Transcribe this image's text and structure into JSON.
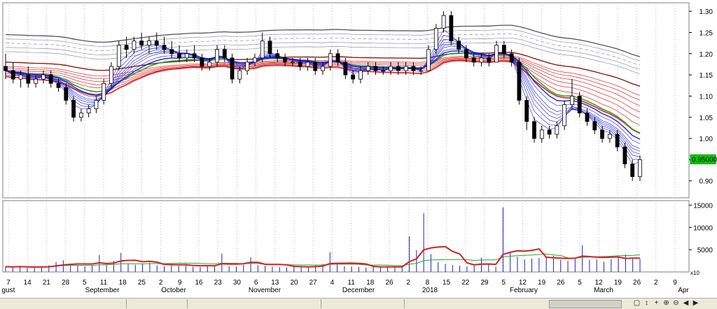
{
  "chart_data": [
    {
      "type": "candlestick",
      "ylim": [
        0.86,
        1.32
      ],
      "yticks": [
        "0.90",
        "0.95",
        "1.00",
        "1.05",
        "1.10",
        "1.15",
        "1.20",
        "1.25",
        "1.30"
      ],
      "price_label": "0.95000",
      "x_ticks": [
        "7",
        "14",
        "21",
        "28",
        "5",
        "11",
        "18",
        "25",
        "2",
        "9",
        "16",
        "23",
        "30",
        "6",
        "13",
        "20",
        "27",
        "4",
        "11",
        "18",
        "26",
        "2",
        "8",
        "15",
        "22",
        "29",
        "5",
        "12",
        "19",
        "26",
        "5",
        "12",
        "19",
        "26",
        "2",
        "9"
      ],
      "month_labels": [
        "gust",
        "September",
        "October",
        "November",
        "December",
        "2018",
        "February",
        "March",
        "Apr"
      ],
      "candles": [
        {
          "o": 1.17,
          "h": 1.2,
          "l": 1.14,
          "c": 1.16
        },
        {
          "o": 1.16,
          "h": 1.18,
          "l": 1.13,
          "c": 1.14
        },
        {
          "o": 1.14,
          "h": 1.16,
          "l": 1.12,
          "c": 1.15
        },
        {
          "o": 1.15,
          "h": 1.17,
          "l": 1.12,
          "c": 1.13
        },
        {
          "o": 1.13,
          "h": 1.15,
          "l": 1.12,
          "c": 1.14
        },
        {
          "o": 1.14,
          "h": 1.16,
          "l": 1.13,
          "c": 1.15
        },
        {
          "o": 1.15,
          "h": 1.16,
          "l": 1.12,
          "c": 1.13
        },
        {
          "o": 1.13,
          "h": 1.14,
          "l": 1.11,
          "c": 1.12
        },
        {
          "o": 1.12,
          "h": 1.13,
          "l": 1.08,
          "c": 1.09
        },
        {
          "o": 1.09,
          "h": 1.1,
          "l": 1.04,
          "c": 1.05
        },
        {
          "o": 1.05,
          "h": 1.07,
          "l": 1.04,
          "c": 1.06
        },
        {
          "o": 1.06,
          "h": 1.08,
          "l": 1.05,
          "c": 1.07
        },
        {
          "o": 1.07,
          "h": 1.1,
          "l": 1.06,
          "c": 1.09
        },
        {
          "o": 1.09,
          "h": 1.14,
          "l": 1.08,
          "c": 1.13
        },
        {
          "o": 1.13,
          "h": 1.18,
          "l": 1.12,
          "c": 1.17
        },
        {
          "o": 1.17,
          "h": 1.23,
          "l": 1.16,
          "c": 1.22
        },
        {
          "o": 1.22,
          "h": 1.24,
          "l": 1.19,
          "c": 1.21
        },
        {
          "o": 1.21,
          "h": 1.24,
          "l": 1.2,
          "c": 1.23
        },
        {
          "o": 1.23,
          "h": 1.25,
          "l": 1.21,
          "c": 1.22
        },
        {
          "o": 1.22,
          "h": 1.24,
          "l": 1.2,
          "c": 1.23
        },
        {
          "o": 1.23,
          "h": 1.25,
          "l": 1.21,
          "c": 1.22
        },
        {
          "o": 1.22,
          "h": 1.24,
          "l": 1.2,
          "c": 1.21
        },
        {
          "o": 1.21,
          "h": 1.23,
          "l": 1.19,
          "c": 1.2
        },
        {
          "o": 1.2,
          "h": 1.22,
          "l": 1.18,
          "c": 1.19
        },
        {
          "o": 1.19,
          "h": 1.21,
          "l": 1.18,
          "c": 1.2
        },
        {
          "o": 1.2,
          "h": 1.22,
          "l": 1.18,
          "c": 1.19
        },
        {
          "o": 1.19,
          "h": 1.2,
          "l": 1.16,
          "c": 1.17
        },
        {
          "o": 1.17,
          "h": 1.19,
          "l": 1.16,
          "c": 1.18
        },
        {
          "o": 1.18,
          "h": 1.22,
          "l": 1.17,
          "c": 1.21
        },
        {
          "o": 1.21,
          "h": 1.22,
          "l": 1.18,
          "c": 1.19
        },
        {
          "o": 1.19,
          "h": 1.2,
          "l": 1.13,
          "c": 1.14
        },
        {
          "o": 1.14,
          "h": 1.17,
          "l": 1.13,
          "c": 1.16
        },
        {
          "o": 1.16,
          "h": 1.19,
          "l": 1.15,
          "c": 1.18
        },
        {
          "o": 1.18,
          "h": 1.2,
          "l": 1.17,
          "c": 1.19
        },
        {
          "o": 1.19,
          "h": 1.25,
          "l": 1.18,
          "c": 1.23
        },
        {
          "o": 1.23,
          "h": 1.24,
          "l": 1.19,
          "c": 1.2
        },
        {
          "o": 1.2,
          "h": 1.21,
          "l": 1.18,
          "c": 1.19
        },
        {
          "o": 1.19,
          "h": 1.2,
          "l": 1.17,
          "c": 1.18
        },
        {
          "o": 1.18,
          "h": 1.19,
          "l": 1.17,
          "c": 1.18
        },
        {
          "o": 1.18,
          "h": 1.19,
          "l": 1.16,
          "c": 1.17
        },
        {
          "o": 1.17,
          "h": 1.19,
          "l": 1.16,
          "c": 1.18
        },
        {
          "o": 1.18,
          "h": 1.19,
          "l": 1.15,
          "c": 1.16
        },
        {
          "o": 1.16,
          "h": 1.18,
          "l": 1.15,
          "c": 1.17
        },
        {
          "o": 1.17,
          "h": 1.21,
          "l": 1.16,
          "c": 1.2
        },
        {
          "o": 1.2,
          "h": 1.21,
          "l": 1.17,
          "c": 1.18
        },
        {
          "o": 1.18,
          "h": 1.19,
          "l": 1.14,
          "c": 1.15
        },
        {
          "o": 1.15,
          "h": 1.16,
          "l": 1.13,
          "c": 1.14
        },
        {
          "o": 1.14,
          "h": 1.17,
          "l": 1.13,
          "c": 1.16
        },
        {
          "o": 1.16,
          "h": 1.18,
          "l": 1.15,
          "c": 1.17
        },
        {
          "o": 1.17,
          "h": 1.18,
          "l": 1.15,
          "c": 1.16
        },
        {
          "o": 1.16,
          "h": 1.17,
          "l": 1.15,
          "c": 1.16
        },
        {
          "o": 1.16,
          "h": 1.18,
          "l": 1.15,
          "c": 1.17
        },
        {
          "o": 1.17,
          "h": 1.18,
          "l": 1.15,
          "c": 1.16
        },
        {
          "o": 1.16,
          "h": 1.18,
          "l": 1.15,
          "c": 1.17
        },
        {
          "o": 1.17,
          "h": 1.18,
          "l": 1.15,
          "c": 1.16
        },
        {
          "o": 1.16,
          "h": 1.17,
          "l": 1.15,
          "c": 1.16
        },
        {
          "o": 1.16,
          "h": 1.22,
          "l": 1.16,
          "c": 1.21
        },
        {
          "o": 1.21,
          "h": 1.27,
          "l": 1.2,
          "c": 1.26
        },
        {
          "o": 1.26,
          "h": 1.3,
          "l": 1.25,
          "c": 1.29
        },
        {
          "o": 1.29,
          "h": 1.3,
          "l": 1.22,
          "c": 1.23
        },
        {
          "o": 1.23,
          "h": 1.24,
          "l": 1.2,
          "c": 1.21
        },
        {
          "o": 1.21,
          "h": 1.22,
          "l": 1.18,
          "c": 1.19
        },
        {
          "o": 1.19,
          "h": 1.2,
          "l": 1.17,
          "c": 1.18
        },
        {
          "o": 1.18,
          "h": 1.2,
          "l": 1.17,
          "c": 1.19
        },
        {
          "o": 1.19,
          "h": 1.2,
          "l": 1.17,
          "c": 1.18
        },
        {
          "o": 1.18,
          "h": 1.23,
          "l": 1.18,
          "c": 1.22
        },
        {
          "o": 1.22,
          "h": 1.23,
          "l": 1.19,
          "c": 1.2
        },
        {
          "o": 1.2,
          "h": 1.21,
          "l": 1.17,
          "c": 1.18
        },
        {
          "o": 1.18,
          "h": 1.19,
          "l": 1.08,
          "c": 1.09
        },
        {
          "o": 1.09,
          "h": 1.1,
          "l": 1.02,
          "c": 1.04
        },
        {
          "o": 1.04,
          "h": 1.05,
          "l": 0.99,
          "c": 1.0
        },
        {
          "o": 1.0,
          "h": 1.03,
          "l": 0.99,
          "c": 1.02
        },
        {
          "o": 1.02,
          "h": 1.03,
          "l": 1.0,
          "c": 1.01
        },
        {
          "o": 1.01,
          "h": 1.04,
          "l": 1.0,
          "c": 1.03
        },
        {
          "o": 1.03,
          "h": 1.09,
          "l": 1.02,
          "c": 1.08
        },
        {
          "o": 1.08,
          "h": 1.14,
          "l": 1.07,
          "c": 1.1
        },
        {
          "o": 1.1,
          "h": 1.11,
          "l": 1.05,
          "c": 1.06
        },
        {
          "o": 1.06,
          "h": 1.07,
          "l": 1.03,
          "c": 1.04
        },
        {
          "o": 1.04,
          "h": 1.05,
          "l": 1.01,
          "c": 1.02
        },
        {
          "o": 1.02,
          "h": 1.03,
          "l": 0.99,
          "c": 1.0
        },
        {
          "o": 1.0,
          "h": 1.02,
          "l": 0.99,
          "c": 1.01
        },
        {
          "o": 1.01,
          "h": 1.02,
          "l": 0.97,
          "c": 0.98
        },
        {
          "o": 0.98,
          "h": 0.99,
          "l": 0.93,
          "c": 0.94
        },
        {
          "o": 0.94,
          "h": 0.95,
          "l": 0.9,
          "c": 0.91
        },
        {
          "o": 0.91,
          "h": 0.96,
          "l": 0.9,
          "c": 0.95
        }
      ],
      "moving_average_colors": [
        "#1a1ad4",
        "#22aa22",
        "#d42020",
        "#8b1a10",
        "#555555"
      ],
      "volume": {
        "ylim": [
          0,
          16000
        ],
        "yticks": [
          "5000",
          "10000",
          "15000"
        ],
        "scale_label": "x10",
        "values": [
          1200,
          1100,
          1300,
          900,
          1000,
          1200,
          1500,
          2200,
          2600,
          1800,
          1500,
          1200,
          1400,
          3800,
          1600,
          2500,
          4300,
          1900,
          1600,
          1800,
          2100,
          1500,
          1300,
          1600,
          1400,
          1800,
          1200,
          1100,
          1400,
          1500,
          4100,
          1300,
          1200,
          1600,
          3300,
          1500,
          1400,
          1200,
          1100,
          1000,
          1300,
          1200,
          1100,
          1500,
          1800,
          4400,
          1700,
          1300,
          1200,
          1100,
          1000,
          1200,
          1100,
          1300,
          1100,
          1200,
          8000,
          4900,
          13200,
          4000,
          2200,
          1800,
          1600,
          1400,
          1200,
          1400,
          3200,
          1900,
          1200,
          14500,
          4200,
          3400,
          2800,
          3000,
          3100,
          3300,
          3600,
          2700,
          2500,
          3200,
          6000,
          2700,
          2800,
          2300,
          2900,
          3500,
          3900,
          3100,
          2900
        ]
      }
    }
  ],
  "bottom_bar": {
    "nav_icons": [
      "page-icon",
      "move-updown-icon",
      "plus-icon",
      "zoom-in-icon",
      "zoom-out-icon",
      "scroll-left-icon",
      "scroll-right-icon"
    ]
  }
}
